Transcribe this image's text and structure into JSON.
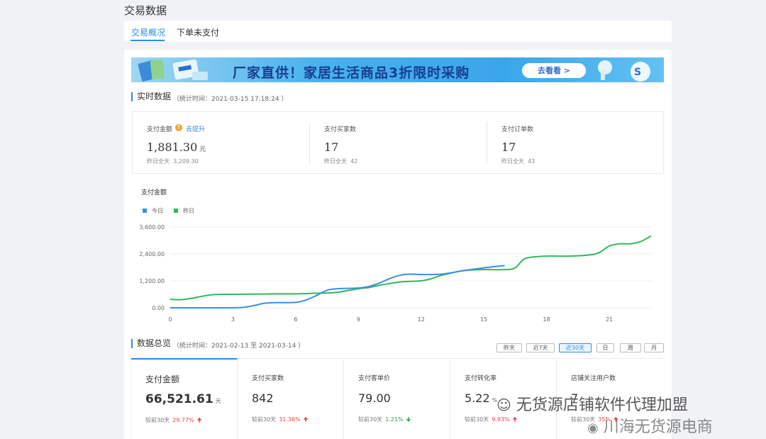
{
  "page": {
    "title": "交易数据"
  },
  "tabs": [
    {
      "label": "交易概况",
      "active": true
    },
    {
      "label": "下单未支付",
      "active": false
    }
  ],
  "banner": {
    "headline": "厂家直供！家居生活商品3折限时采购",
    "button": "去看看 >"
  },
  "realtime": {
    "title": "实时数据",
    "stat_time": "（统计时间：2021-03-15 17:18:24 ）",
    "kpis": [
      {
        "label": "支付金额",
        "value": "1,881.30",
        "unit": "元",
        "prev_label": "昨日全天",
        "prev_value": "3,209.30",
        "link": "去提升"
      },
      {
        "label": "支付买家数",
        "value": "17",
        "unit": "",
        "prev_label": "昨日全天",
        "prev_value": "42"
      },
      {
        "label": "支付订单数",
        "value": "17",
        "unit": "",
        "prev_label": "昨日全天",
        "prev_value": "43"
      }
    ]
  },
  "chart_data": {
    "type": "line",
    "title": "支付金额",
    "legend": [
      "今日",
      "昨日"
    ],
    "legend_position": "top-left",
    "x_ticks": [
      0,
      3,
      6,
      9,
      12,
      15,
      18,
      21
    ],
    "y_ticks": [
      "0.00",
      "1,200.00",
      "2,400.00",
      "3,600.00"
    ],
    "xlim": [
      0,
      23
    ],
    "ylim": [
      0,
      3600
    ],
    "grid": true,
    "series": [
      {
        "name": "今日",
        "color": "#3a8ee6",
        "x": [
          0,
          1,
          2,
          3,
          3.5,
          4,
          4.5,
          5,
          6,
          6.5,
          7,
          7.5,
          8,
          9,
          9.5,
          10,
          10.5,
          11,
          11.5,
          12,
          13,
          14,
          15,
          16
        ],
        "y": [
          0,
          0,
          0,
          0,
          20,
          100,
          200,
          230,
          240,
          350,
          550,
          780,
          850,
          880,
          950,
          1100,
          1300,
          1450,
          1500,
          1480,
          1500,
          1650,
          1780,
          1881
        ]
      },
      {
        "name": "昨日",
        "color": "#32b85a",
        "x": [
          0,
          0.5,
          1,
          2,
          3,
          4,
          5,
          6,
          7,
          7.5,
          8,
          9,
          9.5,
          10,
          11,
          12,
          12.5,
          13,
          14,
          15,
          16,
          16.5,
          17,
          18,
          19,
          20,
          20.5,
          21,
          21.5,
          22,
          22.5,
          23
        ],
        "y": [
          380,
          360,
          420,
          580,
          600,
          610,
          620,
          620,
          650,
          660,
          690,
          850,
          900,
          1000,
          1150,
          1200,
          1300,
          1450,
          1650,
          1700,
          1700,
          1780,
          2200,
          2300,
          2300,
          2350,
          2450,
          2750,
          2850,
          2850,
          2950,
          3200
        ]
      }
    ]
  },
  "overview": {
    "title": "数据总览",
    "stat_time": "（统计时间：2021-02-13 至 2021-03-14 ）",
    "ranges": [
      {
        "label": "昨天"
      },
      {
        "label": "近7天"
      },
      {
        "label": "近30天",
        "active": true
      },
      {
        "label": "日"
      },
      {
        "label": "周"
      },
      {
        "label": "月"
      }
    ],
    "cards": [
      {
        "label": "支付金额",
        "value": "66,521.61",
        "unit": "元",
        "cmp_label": "较前30天",
        "cmp_value": "29.77%",
        "dir": "up"
      },
      {
        "label": "支付买家数",
        "value": "842",
        "unit": "",
        "cmp_label": "较前30天",
        "cmp_value": "31.36%",
        "dir": "up"
      },
      {
        "label": "支付客单价",
        "value": "79.00",
        "unit": "",
        "cmp_label": "较前30天",
        "cmp_value": "1.21%",
        "dir": "down"
      },
      {
        "label": "支付转化率",
        "value": "5.22",
        "unit": "%",
        "cmp_label": "较前30天",
        "cmp_value": "9.93%",
        "dir": "up"
      },
      {
        "label": "店铺关注用户数",
        "value": "7",
        "unit": "",
        "cmp_label": "较前30天",
        "cmp_value": "35%",
        "dir": "up"
      }
    ]
  },
  "watermark": {
    "line1": "无货源店铺软件代理加盟",
    "line2": "川海无货源电商"
  }
}
